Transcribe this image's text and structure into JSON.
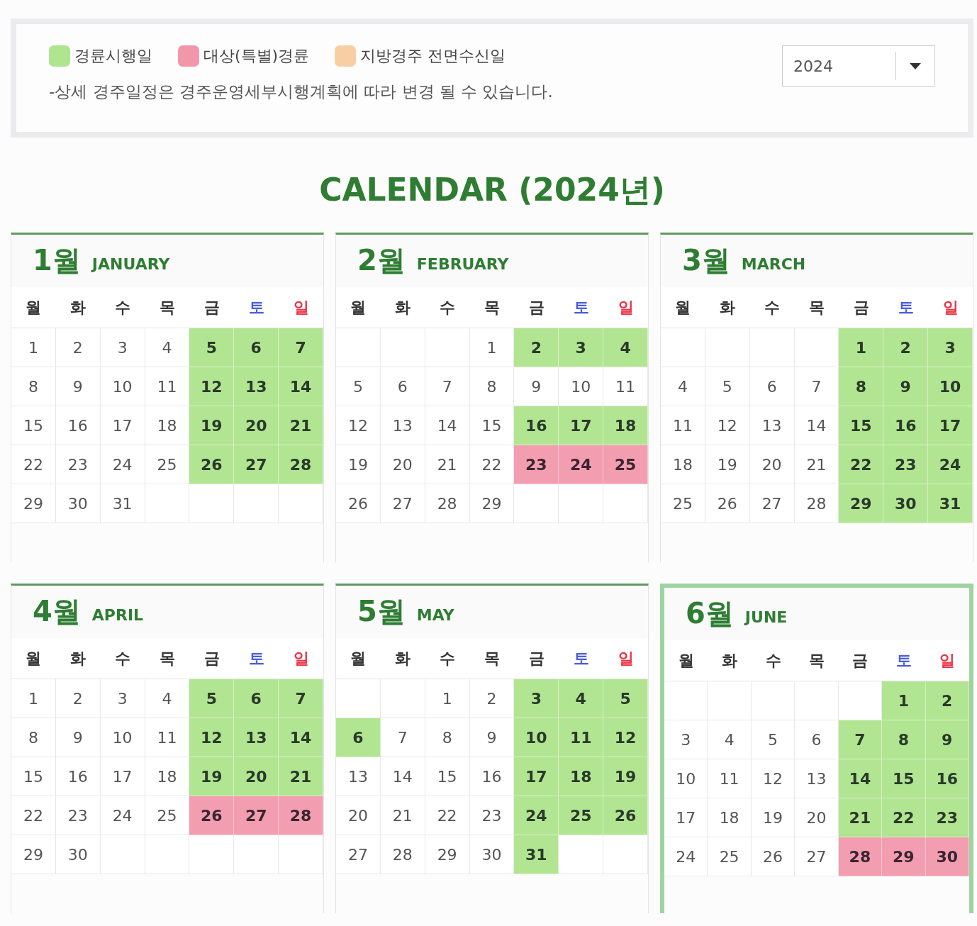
{
  "legend": [
    {
      "label": "경륜시행일",
      "color": "#aee58f"
    },
    {
      "label": "대상(특별)경륜",
      "color": "#f297aa"
    },
    {
      "label": "지방경주 전면수신일",
      "color": "#f8cfa5"
    }
  ],
  "note": "-상세 경주일정은 경주운영세부시행계획에 따라 변경 될 수 있습니다.",
  "year_select": {
    "value": "2024"
  },
  "title": "CALENDAR (2024년)",
  "months": [
    {
      "label": "1월",
      "name": "JANUARY",
      "selected": false,
      "weekdays": [
        {
          "t": "월",
          "kind": "weekday"
        },
        {
          "t": "화",
          "kind": "weekday"
        },
        {
          "t": "수",
          "kind": "weekday"
        },
        {
          "t": "목",
          "kind": "weekday"
        },
        {
          "t": "금",
          "kind": "weekday"
        },
        {
          "t": "토",
          "kind": "sat"
        },
        {
          "t": "일",
          "kind": "sun"
        }
      ],
      "weeks": [
        [
          {
            "d": "1",
            "kind": "plain"
          },
          {
            "d": "2",
            "kind": "plain"
          },
          {
            "d": "3",
            "kind": "plain"
          },
          {
            "d": "4",
            "kind": "plain"
          },
          {
            "d": "5",
            "kind": "race"
          },
          {
            "d": "6",
            "kind": "race"
          },
          {
            "d": "7",
            "kind": "race"
          }
        ],
        [
          {
            "d": "8",
            "kind": "plain"
          },
          {
            "d": "9",
            "kind": "plain"
          },
          {
            "d": "10",
            "kind": "plain"
          },
          {
            "d": "11",
            "kind": "plain"
          },
          {
            "d": "12",
            "kind": "race"
          },
          {
            "d": "13",
            "kind": "race"
          },
          {
            "d": "14",
            "kind": "race"
          }
        ],
        [
          {
            "d": "15",
            "kind": "plain"
          },
          {
            "d": "16",
            "kind": "plain"
          },
          {
            "d": "17",
            "kind": "plain"
          },
          {
            "d": "18",
            "kind": "plain"
          },
          {
            "d": "19",
            "kind": "race"
          },
          {
            "d": "20",
            "kind": "race"
          },
          {
            "d": "21",
            "kind": "race"
          }
        ],
        [
          {
            "d": "22",
            "kind": "plain"
          },
          {
            "d": "23",
            "kind": "plain"
          },
          {
            "d": "24",
            "kind": "plain"
          },
          {
            "d": "25",
            "kind": "plain"
          },
          {
            "d": "26",
            "kind": "race"
          },
          {
            "d": "27",
            "kind": "race"
          },
          {
            "d": "28",
            "kind": "race"
          }
        ],
        [
          {
            "d": "29",
            "kind": "plain"
          },
          {
            "d": "30",
            "kind": "plain"
          },
          {
            "d": "31",
            "kind": "plain"
          },
          {
            "kind": "blank"
          },
          {
            "kind": "blank"
          },
          {
            "kind": "blank"
          },
          {
            "kind": "blank"
          }
        ]
      ]
    },
    {
      "label": "2월",
      "name": "FEBRUARY",
      "selected": false,
      "weekdays": [
        {
          "t": "월",
          "kind": "weekday"
        },
        {
          "t": "화",
          "kind": "weekday"
        },
        {
          "t": "수",
          "kind": "weekday"
        },
        {
          "t": "목",
          "kind": "weekday"
        },
        {
          "t": "금",
          "kind": "weekday"
        },
        {
          "t": "토",
          "kind": "sat"
        },
        {
          "t": "일",
          "kind": "sun"
        }
      ],
      "weeks": [
        [
          {
            "kind": "blank"
          },
          {
            "kind": "blank"
          },
          {
            "kind": "blank"
          },
          {
            "d": "1",
            "kind": "plain"
          },
          {
            "d": "2",
            "kind": "race"
          },
          {
            "d": "3",
            "kind": "race"
          },
          {
            "d": "4",
            "kind": "race"
          }
        ],
        [
          {
            "d": "5",
            "kind": "plain"
          },
          {
            "d": "6",
            "kind": "plain"
          },
          {
            "d": "7",
            "kind": "plain"
          },
          {
            "d": "8",
            "kind": "plain"
          },
          {
            "d": "9",
            "kind": "plain"
          },
          {
            "d": "10",
            "kind": "plain"
          },
          {
            "d": "11",
            "kind": "plain"
          }
        ],
        [
          {
            "d": "12",
            "kind": "plain"
          },
          {
            "d": "13",
            "kind": "plain"
          },
          {
            "d": "14",
            "kind": "plain"
          },
          {
            "d": "15",
            "kind": "plain"
          },
          {
            "d": "16",
            "kind": "race"
          },
          {
            "d": "17",
            "kind": "race"
          },
          {
            "d": "18",
            "kind": "race"
          }
        ],
        [
          {
            "d": "19",
            "kind": "plain"
          },
          {
            "d": "20",
            "kind": "plain"
          },
          {
            "d": "21",
            "kind": "plain"
          },
          {
            "d": "22",
            "kind": "plain"
          },
          {
            "d": "23",
            "kind": "special"
          },
          {
            "d": "24",
            "kind": "special"
          },
          {
            "d": "25",
            "kind": "special"
          }
        ],
        [
          {
            "d": "26",
            "kind": "plain"
          },
          {
            "d": "27",
            "kind": "plain"
          },
          {
            "d": "28",
            "kind": "plain"
          },
          {
            "d": "29",
            "kind": "plain"
          },
          {
            "kind": "blank"
          },
          {
            "kind": "blank"
          },
          {
            "kind": "blank"
          }
        ]
      ]
    },
    {
      "label": "3월",
      "name": "MARCH",
      "selected": false,
      "weekdays": [
        {
          "t": "월",
          "kind": "weekday"
        },
        {
          "t": "화",
          "kind": "weekday"
        },
        {
          "t": "수",
          "kind": "weekday"
        },
        {
          "t": "목",
          "kind": "weekday"
        },
        {
          "t": "금",
          "kind": "weekday"
        },
        {
          "t": "토",
          "kind": "sat"
        },
        {
          "t": "일",
          "kind": "sun"
        }
      ],
      "weeks": [
        [
          {
            "kind": "blank"
          },
          {
            "kind": "blank"
          },
          {
            "kind": "blank"
          },
          {
            "kind": "blank"
          },
          {
            "d": "1",
            "kind": "race"
          },
          {
            "d": "2",
            "kind": "race"
          },
          {
            "d": "3",
            "kind": "race"
          }
        ],
        [
          {
            "d": "4",
            "kind": "plain"
          },
          {
            "d": "5",
            "kind": "plain"
          },
          {
            "d": "6",
            "kind": "plain"
          },
          {
            "d": "7",
            "kind": "plain"
          },
          {
            "d": "8",
            "kind": "race"
          },
          {
            "d": "9",
            "kind": "race"
          },
          {
            "d": "10",
            "kind": "race"
          }
        ],
        [
          {
            "d": "11",
            "kind": "plain"
          },
          {
            "d": "12",
            "kind": "plain"
          },
          {
            "d": "13",
            "kind": "plain"
          },
          {
            "d": "14",
            "kind": "plain"
          },
          {
            "d": "15",
            "kind": "race"
          },
          {
            "d": "16",
            "kind": "race"
          },
          {
            "d": "17",
            "kind": "race"
          }
        ],
        [
          {
            "d": "18",
            "kind": "plain"
          },
          {
            "d": "19",
            "kind": "plain"
          },
          {
            "d": "20",
            "kind": "plain"
          },
          {
            "d": "21",
            "kind": "plain"
          },
          {
            "d": "22",
            "kind": "race"
          },
          {
            "d": "23",
            "kind": "race"
          },
          {
            "d": "24",
            "kind": "race"
          }
        ],
        [
          {
            "d": "25",
            "kind": "plain"
          },
          {
            "d": "26",
            "kind": "plain"
          },
          {
            "d": "27",
            "kind": "plain"
          },
          {
            "d": "28",
            "kind": "plain"
          },
          {
            "d": "29",
            "kind": "race"
          },
          {
            "d": "30",
            "kind": "race"
          },
          {
            "d": "31",
            "kind": "race"
          }
        ]
      ]
    },
    {
      "label": "4월",
      "name": "APRIL",
      "selected": false,
      "weekdays": [
        {
          "t": "월",
          "kind": "weekday"
        },
        {
          "t": "화",
          "kind": "weekday"
        },
        {
          "t": "수",
          "kind": "weekday"
        },
        {
          "t": "목",
          "kind": "weekday"
        },
        {
          "t": "금",
          "kind": "weekday"
        },
        {
          "t": "토",
          "kind": "sat"
        },
        {
          "t": "일",
          "kind": "sun"
        }
      ],
      "weeks": [
        [
          {
            "d": "1",
            "kind": "plain"
          },
          {
            "d": "2",
            "kind": "plain"
          },
          {
            "d": "3",
            "kind": "plain"
          },
          {
            "d": "4",
            "kind": "plain"
          },
          {
            "d": "5",
            "kind": "race"
          },
          {
            "d": "6",
            "kind": "race"
          },
          {
            "d": "7",
            "kind": "race"
          }
        ],
        [
          {
            "d": "8",
            "kind": "plain"
          },
          {
            "d": "9",
            "kind": "plain"
          },
          {
            "d": "10",
            "kind": "plain"
          },
          {
            "d": "11",
            "kind": "plain"
          },
          {
            "d": "12",
            "kind": "race"
          },
          {
            "d": "13",
            "kind": "race"
          },
          {
            "d": "14",
            "kind": "race"
          }
        ],
        [
          {
            "d": "15",
            "kind": "plain"
          },
          {
            "d": "16",
            "kind": "plain"
          },
          {
            "d": "17",
            "kind": "plain"
          },
          {
            "d": "18",
            "kind": "plain"
          },
          {
            "d": "19",
            "kind": "race"
          },
          {
            "d": "20",
            "kind": "race"
          },
          {
            "d": "21",
            "kind": "race"
          }
        ],
        [
          {
            "d": "22",
            "kind": "plain"
          },
          {
            "d": "23",
            "kind": "plain"
          },
          {
            "d": "24",
            "kind": "plain"
          },
          {
            "d": "25",
            "kind": "plain"
          },
          {
            "d": "26",
            "kind": "special"
          },
          {
            "d": "27",
            "kind": "special"
          },
          {
            "d": "28",
            "kind": "special"
          }
        ],
        [
          {
            "d": "29",
            "kind": "plain"
          },
          {
            "d": "30",
            "kind": "plain"
          },
          {
            "kind": "blank"
          },
          {
            "kind": "blank"
          },
          {
            "kind": "blank"
          },
          {
            "kind": "blank"
          },
          {
            "kind": "blank"
          }
        ]
      ]
    },
    {
      "label": "5월",
      "name": "MAY",
      "selected": false,
      "weekdays": [
        {
          "t": "월",
          "kind": "weekday"
        },
        {
          "t": "화",
          "kind": "weekday"
        },
        {
          "t": "수",
          "kind": "weekday"
        },
        {
          "t": "목",
          "kind": "weekday"
        },
        {
          "t": "금",
          "kind": "weekday"
        },
        {
          "t": "토",
          "kind": "sat"
        },
        {
          "t": "일",
          "kind": "sun"
        }
      ],
      "weeks": [
        [
          {
            "kind": "blank"
          },
          {
            "kind": "blank"
          },
          {
            "d": "1",
            "kind": "plain"
          },
          {
            "d": "2",
            "kind": "plain"
          },
          {
            "d": "3",
            "kind": "race"
          },
          {
            "d": "4",
            "kind": "race"
          },
          {
            "d": "5",
            "kind": "race"
          }
        ],
        [
          {
            "d": "6",
            "kind": "race"
          },
          {
            "d": "7",
            "kind": "plain"
          },
          {
            "d": "8",
            "kind": "plain"
          },
          {
            "d": "9",
            "kind": "plain"
          },
          {
            "d": "10",
            "kind": "race"
          },
          {
            "d": "11",
            "kind": "race"
          },
          {
            "d": "12",
            "kind": "race"
          }
        ],
        [
          {
            "d": "13",
            "kind": "plain"
          },
          {
            "d": "14",
            "kind": "plain"
          },
          {
            "d": "15",
            "kind": "plain"
          },
          {
            "d": "16",
            "kind": "plain"
          },
          {
            "d": "17",
            "kind": "race"
          },
          {
            "d": "18",
            "kind": "race"
          },
          {
            "d": "19",
            "kind": "race"
          }
        ],
        [
          {
            "d": "20",
            "kind": "plain"
          },
          {
            "d": "21",
            "kind": "plain"
          },
          {
            "d": "22",
            "kind": "plain"
          },
          {
            "d": "23",
            "kind": "plain"
          },
          {
            "d": "24",
            "kind": "race"
          },
          {
            "d": "25",
            "kind": "race"
          },
          {
            "d": "26",
            "kind": "race"
          }
        ],
        [
          {
            "d": "27",
            "kind": "plain"
          },
          {
            "d": "28",
            "kind": "plain"
          },
          {
            "d": "29",
            "kind": "plain"
          },
          {
            "d": "30",
            "kind": "plain"
          },
          {
            "d": "31",
            "kind": "race"
          },
          {
            "kind": "blank"
          },
          {
            "kind": "blank"
          }
        ]
      ]
    },
    {
      "label": "6월",
      "name": "JUNE",
      "selected": true,
      "weekdays": [
        {
          "t": "월",
          "kind": "weekday"
        },
        {
          "t": "화",
          "kind": "weekday"
        },
        {
          "t": "수",
          "kind": "weekday"
        },
        {
          "t": "목",
          "kind": "weekday"
        },
        {
          "t": "금",
          "kind": "weekday"
        },
        {
          "t": "토",
          "kind": "sat"
        },
        {
          "t": "일",
          "kind": "sun"
        }
      ],
      "weeks": [
        [
          {
            "kind": "blank"
          },
          {
            "kind": "blank"
          },
          {
            "kind": "blank"
          },
          {
            "kind": "blank"
          },
          {
            "kind": "blank"
          },
          {
            "d": "1",
            "kind": "race"
          },
          {
            "d": "2",
            "kind": "race"
          }
        ],
        [
          {
            "d": "3",
            "kind": "plain"
          },
          {
            "d": "4",
            "kind": "plain"
          },
          {
            "d": "5",
            "kind": "plain"
          },
          {
            "d": "6",
            "kind": "plain"
          },
          {
            "d": "7",
            "kind": "race"
          },
          {
            "d": "8",
            "kind": "race"
          },
          {
            "d": "9",
            "kind": "race"
          }
        ],
        [
          {
            "d": "10",
            "kind": "plain"
          },
          {
            "d": "11",
            "kind": "plain"
          },
          {
            "d": "12",
            "kind": "plain"
          },
          {
            "d": "13",
            "kind": "plain"
          },
          {
            "d": "14",
            "kind": "race"
          },
          {
            "d": "15",
            "kind": "race"
          },
          {
            "d": "16",
            "kind": "race"
          }
        ],
        [
          {
            "d": "17",
            "kind": "plain"
          },
          {
            "d": "18",
            "kind": "plain"
          },
          {
            "d": "19",
            "kind": "plain"
          },
          {
            "d": "20",
            "kind": "plain"
          },
          {
            "d": "21",
            "kind": "race"
          },
          {
            "d": "22",
            "kind": "race"
          },
          {
            "d": "23",
            "kind": "race"
          }
        ],
        [
          {
            "d": "24",
            "kind": "plain"
          },
          {
            "d": "25",
            "kind": "plain"
          },
          {
            "d": "26",
            "kind": "plain"
          },
          {
            "d": "27",
            "kind": "plain"
          },
          {
            "d": "28",
            "kind": "special"
          },
          {
            "d": "29",
            "kind": "special"
          },
          {
            "d": "30",
            "kind": "special"
          }
        ]
      ]
    }
  ]
}
